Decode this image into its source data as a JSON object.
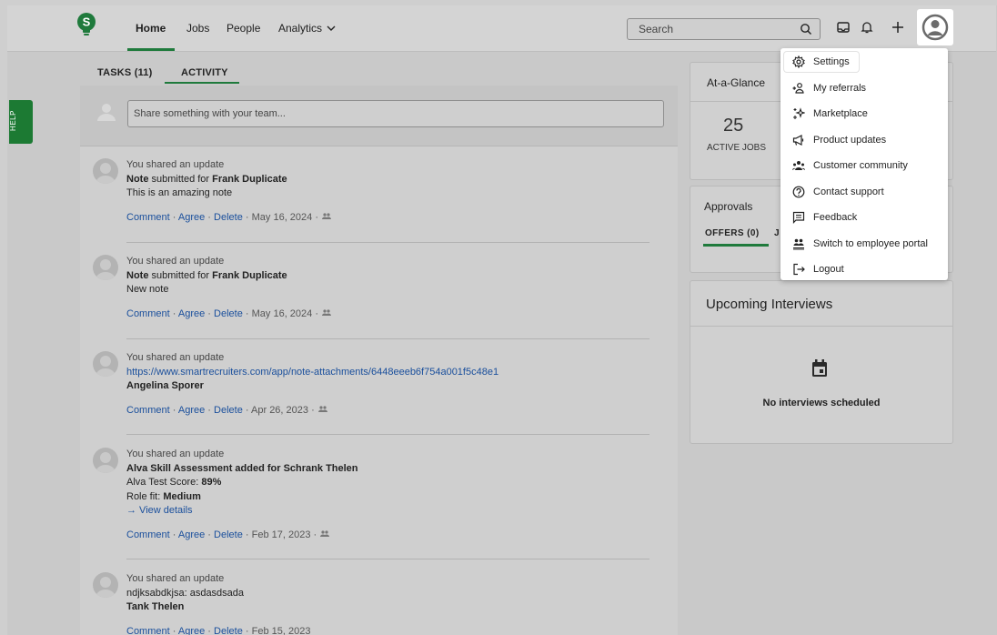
{
  "nav": {
    "items": [
      "Home",
      "Jobs",
      "People",
      "Analytics"
    ],
    "search_placeholder": "Search"
  },
  "help_label": "HELP",
  "tabs": [
    "TASKS (11)",
    "ACTIVITY"
  ],
  "share_placeholder": "Share something with your team...",
  "feed": [
    {
      "headline": "You shared an update",
      "line1_prefix": "Note",
      "line1_mid": " submitted for ",
      "line1_name": "Frank Duplicate",
      "line2": "This is an amazing note",
      "date": "May 16, 2024"
    },
    {
      "headline": "You shared an update",
      "line1_prefix": "Note",
      "line1_mid": " submitted for ",
      "line1_name": "Frank Duplicate",
      "line2": "New note",
      "date": "May 16, 2024"
    },
    {
      "headline": "You shared an update",
      "url": "https://www.smartrecruiters.com/app/note-attachments/6448eeeb6f754a001f5c48e1",
      "name": "Angelina Sporer",
      "date": "Apr 26, 2023"
    },
    {
      "headline": "You shared an update",
      "title": "Alva Skill Assessment added for Schrank Thelen",
      "score_label": "Alva Test Score: ",
      "score_value": "89%",
      "fit_label": "Role fit: ",
      "fit_value": "Medium",
      "view_details": "→ View details",
      "date": "Feb 17, 2023"
    },
    {
      "headline": "You shared an update",
      "line1": "ndjksabdkjsa: asdasdsada",
      "line2": "Tank Thelen",
      "date": "Feb 15, 2023"
    }
  ],
  "actions": {
    "comment": "Comment",
    "agree": "Agree",
    "delete": "Delete",
    "sep": "·"
  },
  "glance": {
    "title": "At-a-Glance",
    "count": "25",
    "label": "ACTIVE JOBS"
  },
  "approvals": {
    "title": "Approvals",
    "offers_tab": "OFFERS (0)",
    "next_tab": "J"
  },
  "interviews": {
    "title": "Upcoming Interviews",
    "empty": "No interviews scheduled"
  },
  "menu": [
    {
      "label": "Settings",
      "icon": "gear-icon"
    },
    {
      "label": "My referrals",
      "icon": "referral-icon"
    },
    {
      "label": "Marketplace",
      "icon": "sparkle-icon"
    },
    {
      "label": "Product updates",
      "icon": "megaphone-icon"
    },
    {
      "label": "Customer community",
      "icon": "community-icon"
    },
    {
      "label": "Contact support",
      "icon": "help-circle-icon"
    },
    {
      "label": "Feedback",
      "icon": "feedback-icon"
    },
    {
      "label": "Switch to employee portal",
      "icon": "switch-portal-icon"
    },
    {
      "label": "Logout",
      "icon": "logout-icon"
    }
  ],
  "colors": {
    "brand_green": "#1f7a3c",
    "link_blue": "#1a4f9c"
  }
}
